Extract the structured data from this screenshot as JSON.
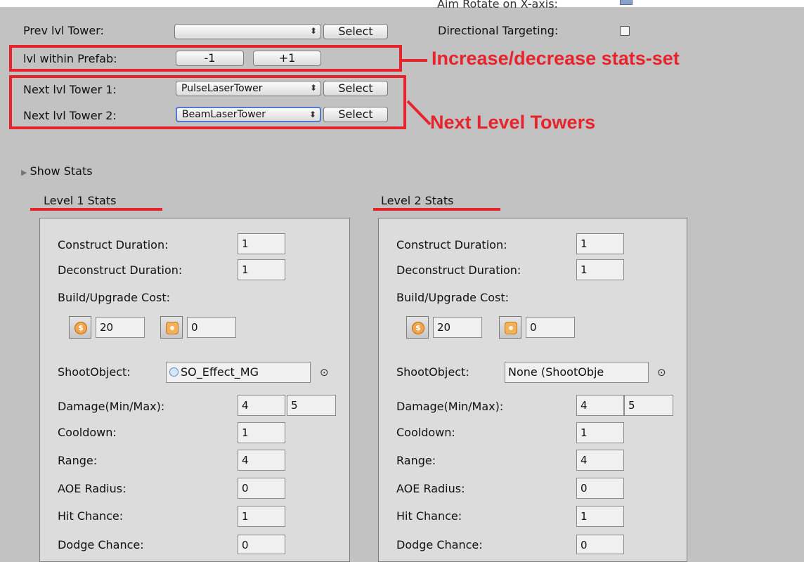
{
  "top_clip": {
    "label": "Aim Rotate on X-axis:"
  },
  "controls": {
    "prev_tower_label": "Prev lvl Tower:",
    "prev_tower_value": "",
    "select_label": "Select",
    "directional_label": "Directional Targeting:",
    "level_within_label": "lvl within Prefab:",
    "minus_label": "-1",
    "plus_label": "+1",
    "next1_label": "Next lvl Tower 1:",
    "next1_value": "PulseLaserTower",
    "next2_label": "Next lvl Tower 2:",
    "next2_value": "BeamLaserTower",
    "popup_arrows": "⬍"
  },
  "annotations": {
    "increase_text": "Increase/decrease stats-set",
    "next_text": "Next Level Towers",
    "color": "#e7232c"
  },
  "foldout": {
    "label": "Show Stats",
    "arrow": "▶"
  },
  "picker_glyph": "⊙",
  "labels": {
    "construct": "Construct Duration:",
    "deconstruct": "Deconstruct Duration:",
    "cost": "Build/Upgrade Cost:",
    "shoot": "ShootObject:",
    "damage": "Damage(Min/Max):",
    "cooldown": "Cooldown:",
    "range": "Range:",
    "aoe": "AOE Radius:",
    "hit": "Hit Chance:",
    "dodge": "Dodge Chance:"
  },
  "levels": [
    {
      "title": "Level 1 Stats",
      "construct": "1",
      "deconstruct": "1",
      "cost_gold": "20",
      "cost_res": "0",
      "shoot": "SO_Effect_MG",
      "damage_min": "4",
      "damage_max": "5",
      "cooldown": "1",
      "range": "4",
      "aoe": "0",
      "hit": "1",
      "dodge": "0"
    },
    {
      "title": "Level 2 Stats",
      "construct": "1",
      "deconstruct": "1",
      "cost_gold": "20",
      "cost_res": "0",
      "shoot": "None (ShootObje",
      "damage_min": "4",
      "damage_max": "5",
      "cooldown": "1",
      "range": "4",
      "aoe": "0",
      "hit": "1",
      "dodge": "0"
    }
  ]
}
